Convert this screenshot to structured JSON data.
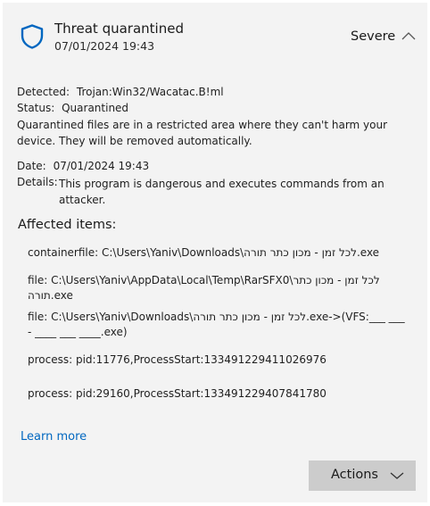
{
  "header": {
    "title": "Threat quarantined",
    "date": "07/01/2024 19:43",
    "severity": "Severe",
    "shield_icon": "shield-icon",
    "collapse_icon": "chevron-up-icon"
  },
  "details": {
    "detected_label": "Detected:",
    "detected_value": "Trojan:Win32/Wacatac.B!ml",
    "status_label": "Status:",
    "status_value": "Quarantined",
    "status_note": "Quarantined files are in a restricted area where they can't harm your device. They will be removed automatically.",
    "date_label": "Date:",
    "date_value": "07/01/2024 19:43",
    "details_label": "Details:",
    "details_value": "This program is dangerous and executes commands from an attacker."
  },
  "affected": {
    "heading": "Affected items:",
    "items": [
      "containerfile: C:\\Users\\Yaniv\\Downloads\\לכל זמן - מכון כתר תורה.exe",
      "file: C:\\Users\\Yaniv\\AppData\\Local\\Temp\\RarSFX0\\לכל זמן - מכון כתר תורה.exe",
      "file: C:\\Users\\Yaniv\\Downloads\\לכל זמן - מכון כתר תורה.exe->(VFS:___ ___ - ____ ___ ____.exe)",
      "process: pid:11776,ProcessStart:133491229411026976",
      "process: pid:29160,ProcessStart:133491229407841780"
    ]
  },
  "footer": {
    "learn_more": "Learn more",
    "actions_label": "Actions",
    "actions_icon": "chevron-down-icon"
  },
  "colors": {
    "panel_bg": "#f3f3f3",
    "accent": "#0067c0",
    "button_bg": "#cccccc"
  }
}
